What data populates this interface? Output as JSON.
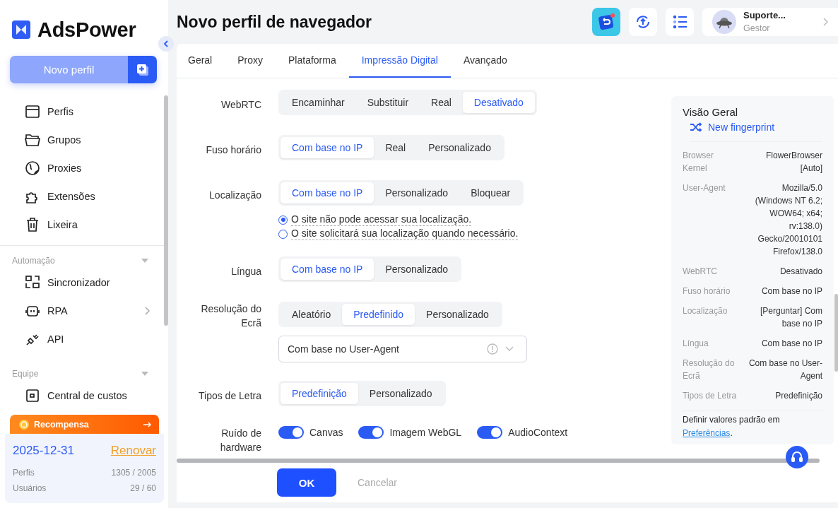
{
  "brand": "AdsPower",
  "new_profile": "Novo perfil",
  "nav_sections": [
    {
      "items": [
        {
          "label": "Perfis",
          "submenu": false
        },
        {
          "label": "Grupos",
          "submenu": false
        },
        {
          "label": "Proxies",
          "submenu": false
        },
        {
          "label": "Extensões",
          "submenu": false
        },
        {
          "label": "Lixeira",
          "submenu": false
        }
      ]
    },
    {
      "title": "Automação",
      "items": [
        {
          "label": "Sincronizador",
          "submenu": false
        },
        {
          "label": "RPA",
          "submenu": true
        },
        {
          "label": "API",
          "submenu": false
        }
      ]
    },
    {
      "title": "Equipe",
      "items": [
        {
          "label": "Central de custos",
          "submenu": false
        }
      ]
    }
  ],
  "reward": "Recompensa",
  "plan": {
    "date": "2025-12-31",
    "renew": "Renovar",
    "stats": [
      {
        "label": "Perfis",
        "value": "1305 / 2005"
      },
      {
        "label": "Usuários",
        "value": "29 / 60"
      }
    ]
  },
  "page_title": "Novo perfil de navegador",
  "user": {
    "name": "Suporte...",
    "role": "Gestor"
  },
  "tabs": [
    {
      "label": "Geral",
      "selected": false
    },
    {
      "label": "Proxy",
      "selected": false
    },
    {
      "label": "Plataforma",
      "selected": false
    },
    {
      "label": "Impressão Digital",
      "selected": true
    },
    {
      "label": "Avançado",
      "selected": false
    }
  ],
  "fields": [
    {
      "kind": "segmented",
      "label": "WebRTC",
      "options": [
        {
          "label": "Encaminhar",
          "selected": false
        },
        {
          "label": "Substituir",
          "selected": false
        },
        {
          "label": "Real",
          "selected": false
        },
        {
          "label": "Desativado",
          "selected": true
        }
      ]
    },
    {
      "kind": "segmented",
      "label": "Fuso horário",
      "options": [
        {
          "label": "Com base no IP",
          "selected": true
        },
        {
          "label": "Real",
          "selected": false
        },
        {
          "label": "Personalizado",
          "selected": false
        }
      ]
    },
    {
      "kind": "segmented",
      "label": "Localização",
      "options": [
        {
          "label": "Com base no IP",
          "selected": true
        },
        {
          "label": "Personalizado",
          "selected": false
        },
        {
          "label": "Bloquear",
          "selected": false
        }
      ],
      "radios": [
        {
          "label": "O site não pode acessar sua localização.",
          "selected": true
        },
        {
          "label": "O site solicitará sua localização quando necessário.",
          "selected": false
        }
      ]
    },
    {
      "kind": "segmented",
      "label": "Língua",
      "options": [
        {
          "label": "Com base no IP",
          "selected": true
        },
        {
          "label": "Personalizado",
          "selected": false
        }
      ]
    },
    {
      "kind": "segmented",
      "label": "Resolução do Ecrã",
      "options": [
        {
          "label": "Aleatório",
          "selected": false
        },
        {
          "label": "Predefinido",
          "selected": true
        },
        {
          "label": "Personalizado",
          "selected": false
        }
      ],
      "select": "Com base no User-Agent"
    },
    {
      "kind": "segmented",
      "label": "Tipos de Letra",
      "options": [
        {
          "label": "Predefinição",
          "selected": true
        },
        {
          "label": "Personalizado",
          "selected": false
        }
      ]
    },
    {
      "kind": "toggles",
      "label": "Ruído de hardware",
      "toggles": [
        {
          "label": "Canvas",
          "on": true
        },
        {
          "label": "Imagem WebGL",
          "on": true
        },
        {
          "label": "AudioContext",
          "on": true
        }
      ]
    }
  ],
  "overview": {
    "title": "Visão Geral",
    "link": "New fingerprint",
    "rows": [
      {
        "label": "Browser Kernel",
        "value": "FlowerBrowser [Auto]"
      },
      {
        "label": "User-Agent",
        "value": "Mozilla/5.0 (Windows NT 6.2; WOW64; x64; rv:138.0) Gecko/20010101 Firefox/138.0"
      },
      {
        "label": "WebRTC",
        "value": "Desativado"
      },
      {
        "label": "Fuso horário",
        "value": "Com base no IP"
      },
      {
        "label": "Localização",
        "value": "[Perguntar] Com base no IP"
      },
      {
        "label": "Língua",
        "value": "Com base no IP"
      },
      {
        "label": "Resolução do Ecrã",
        "value": "Com base no User-Agent"
      },
      {
        "label": "Tipos de Letra",
        "value": "Predefinição"
      }
    ],
    "footer": "Definir valores padrão em",
    "footer_link": "Preferências",
    "footer_end": "."
  },
  "buttons": {
    "ok": "OK",
    "cancel": "Cancelar"
  }
}
